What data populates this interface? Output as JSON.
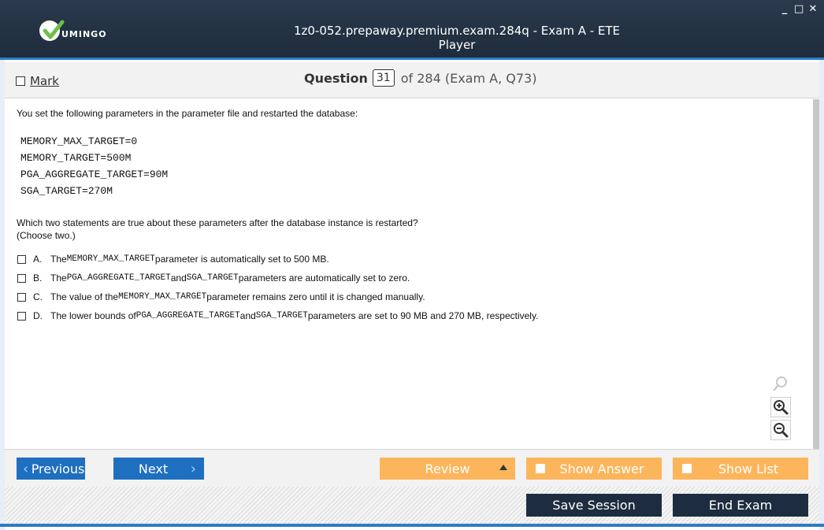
{
  "window": {
    "title": "1z0-052.prepaway.premium.exam.284q - Exam A - ETE Player",
    "logo_text": "UMINGO",
    "controls": [
      "_",
      "□",
      "✕"
    ]
  },
  "header": {
    "mark_label": "Mark",
    "question_label": "Question",
    "question_number": "31",
    "question_of": "of 284 (Exam A, Q73)"
  },
  "question": {
    "intro": "You set the following parameters in the parameter file and restarted the database:",
    "code_lines": [
      "MEMORY_MAX_TARGET=0",
      "MEMORY_TARGET=500M",
      "PGA_AGGREGATE_TARGET=90M",
      "SGA_TARGET=270M"
    ],
    "prompt_line1": "Which two statements are true about these parameters after the database instance is restarted?",
    "prompt_line2": "(Choose two.)",
    "options": [
      {
        "letter": "A.",
        "t1": "The ",
        "m1": "MEMORY_MAX_TARGET",
        "t2": " parameter is automatically set to 500 MB.",
        "m2": "",
        "t3": ""
      },
      {
        "letter": "B.",
        "t1": "The ",
        "m1": "PGA_AGGREGATE_TARGET",
        "t2": " and ",
        "m2": "SGA_TARGET",
        "t3": " parameters are automatically set to zero."
      },
      {
        "letter": "C.",
        "t1": "The value of the ",
        "m1": "MEMORY_MAX_TARGET",
        "t2": " parameter remains zero until it is changed manually.",
        "m2": "",
        "t3": ""
      },
      {
        "letter": "D.",
        "t1": "The lower bounds of ",
        "m1": "PGA_AGGREGATE_TARGET",
        "t2": " and ",
        "m2": "SGA_TARGET",
        "t3": " parameters are set to 90 MB and 270 MB, respectively."
      }
    ]
  },
  "zoom": {
    "icons": [
      "magnifier-icon",
      "zoom-in-icon",
      "zoom-out-icon"
    ]
  },
  "nav": {
    "previous_label": "Previous",
    "next_label": "Next",
    "review_label": "Review",
    "show_answer_label": "Show Answer",
    "show_list_label": "Show List"
  },
  "footer": {
    "save_session_label": "Save Session",
    "end_exam_label": "End Exam"
  },
  "colors": {
    "titlebar": "#1e2c3c",
    "accent_blue": "#1f6fc0",
    "orange": "#fdb55c",
    "dark_button": "#1d2d3f",
    "logo_green": "#6cc04a"
  }
}
